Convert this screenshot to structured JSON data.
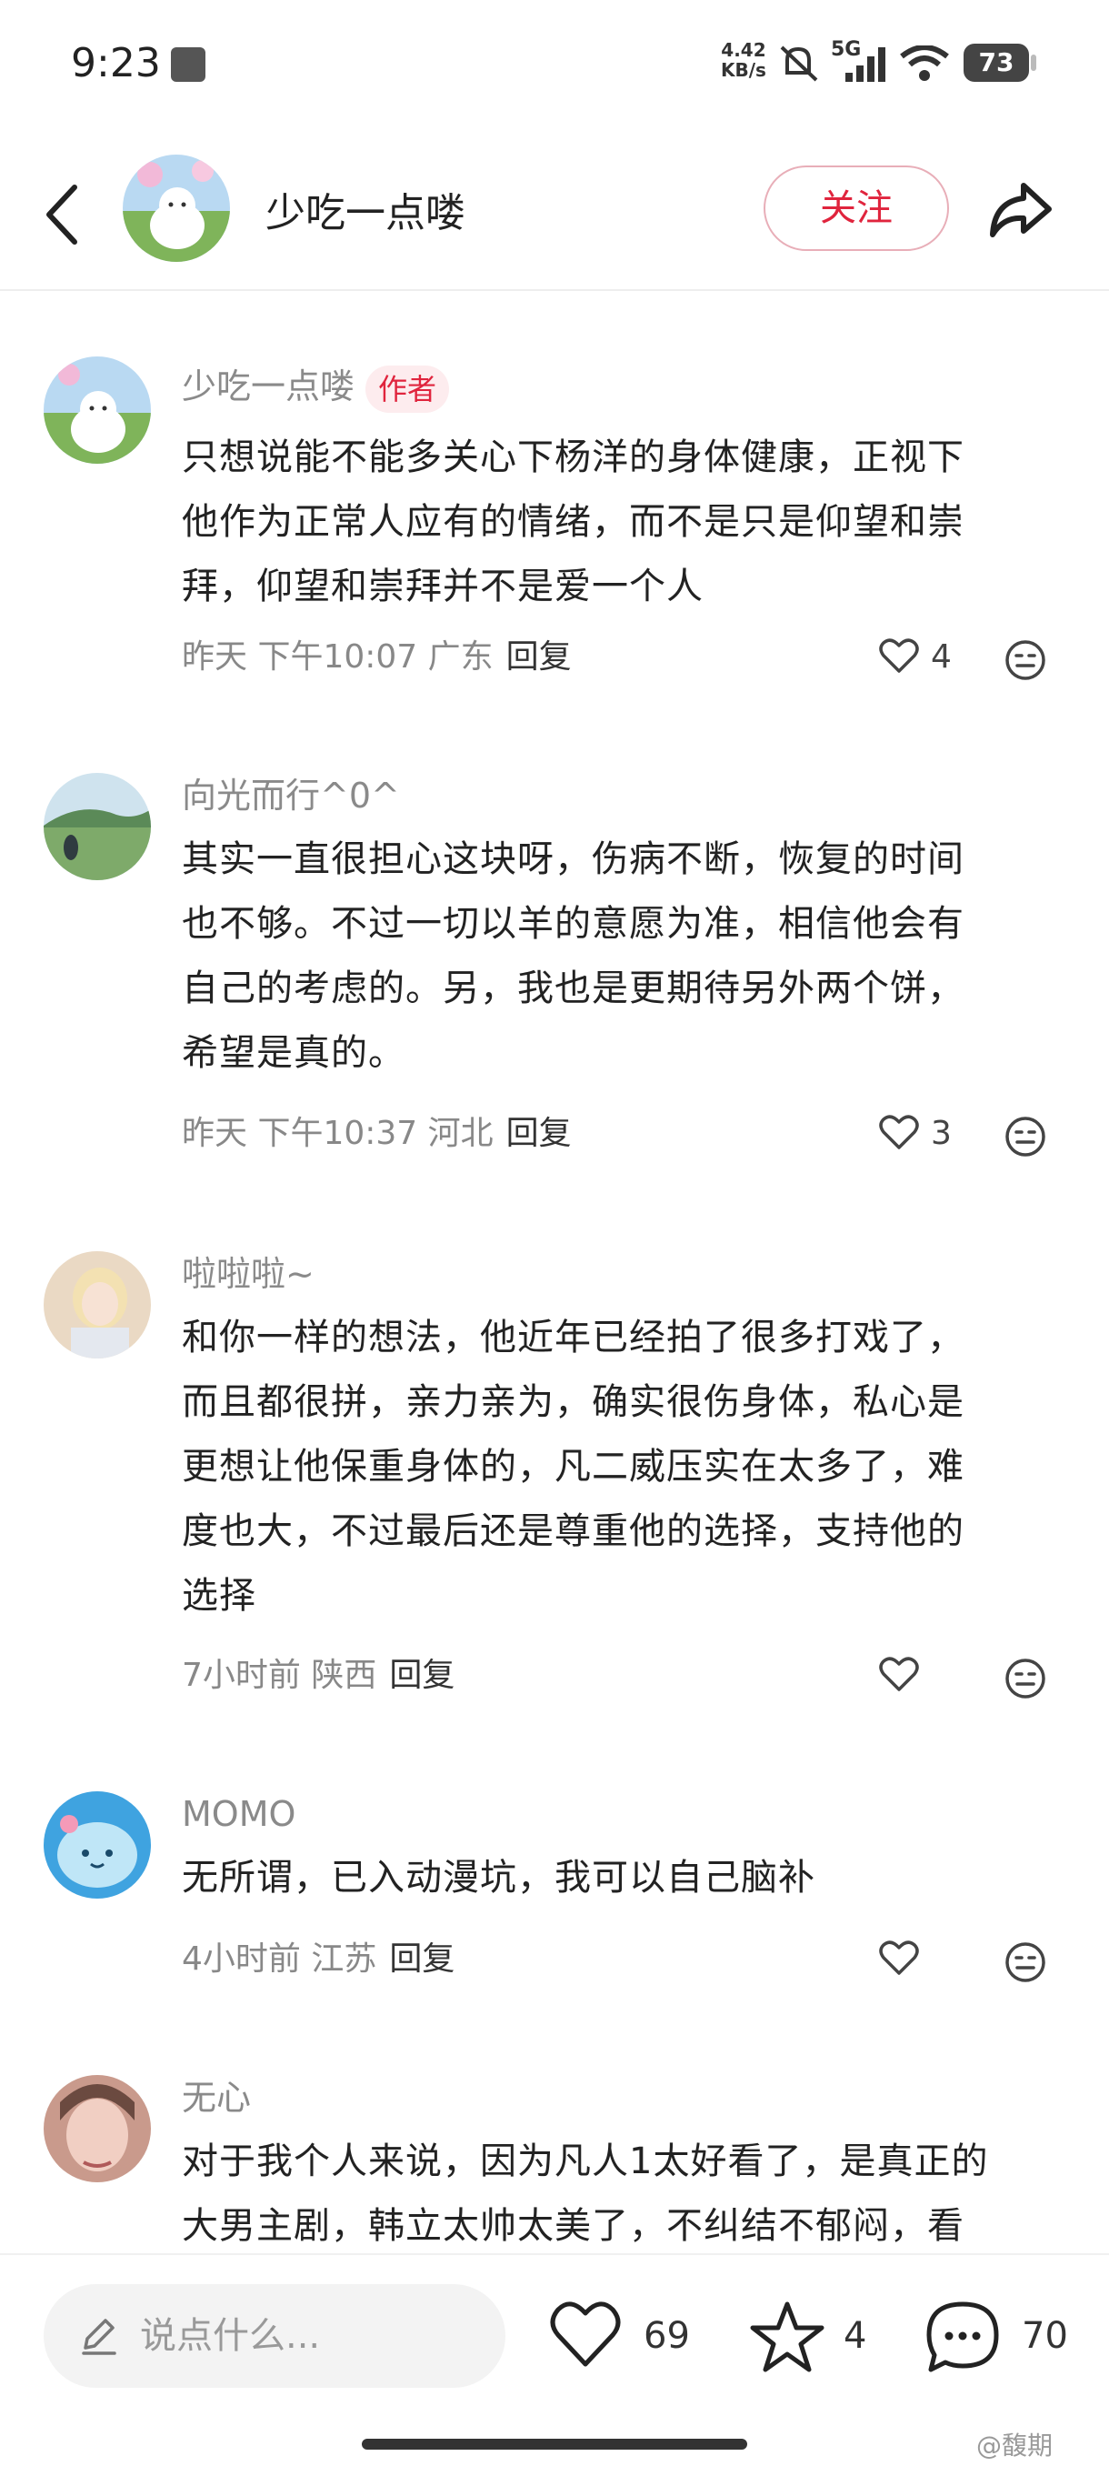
{
  "status_bar": {
    "time": "9:23",
    "net_speed_top": "4.42",
    "net_speed_bottom": "KB/s",
    "network": "5G",
    "battery": "73"
  },
  "header": {
    "title": "少吃一点喽",
    "follow_label": "关注"
  },
  "comments": [
    {
      "name": "少吃一点喽",
      "badge": "作者",
      "lines": [
        "只想说能不能多关心下杨洋的身体健康，正视下",
        "他作为正常人应有的情绪，而不是只是仰望和崇",
        "拜，仰望和崇拜并不是爱一个人"
      ],
      "meta": "昨天 下午10:07 广东",
      "reply": "回复",
      "likes": "4"
    },
    {
      "name": "向光而行^0^",
      "lines": [
        "其实一直很担心这块呀，伤病不断，恢复的时间",
        "也不够。不过一切以羊的意愿为准，相信他会有",
        "自己的考虑的。另，我也是更期待另外两个饼，",
        "希望是真的。"
      ],
      "meta": "昨天 下午10:37 河北",
      "reply": "回复",
      "likes": "3"
    },
    {
      "name": "啦啦啦~",
      "lines": [
        "和你一样的想法，他近年已经拍了很多打戏了，",
        "而且都很拼，亲力亲为，确实很伤身体，私心是",
        "更想让他保重身体的，凡二威压实在太多了，难",
        "度也大，不过最后还是尊重他的选择，支持他的",
        "选择"
      ],
      "meta": "7小时前 陕西",
      "reply": "回复",
      "likes": ""
    },
    {
      "name": "MOMO",
      "lines": [
        "无所谓，已入动漫坑，我可以自己脑补"
      ],
      "meta": "4小时前 江苏",
      "reply": "回复",
      "likes": ""
    },
    {
      "name": "无心",
      "lines": [
        "对于我个人来说，因为凡人1太好看了，是真正的",
        "大男主剧，韩立太帅太美了，不纠结不郁闷，看"
      ],
      "meta": "",
      "reply": "",
      "likes": ""
    }
  ],
  "bottom_bar": {
    "input_placeholder": "说点什么...",
    "like_count": "69",
    "star_count": "4",
    "comment_count": "70"
  },
  "watermark": "@馥期"
}
